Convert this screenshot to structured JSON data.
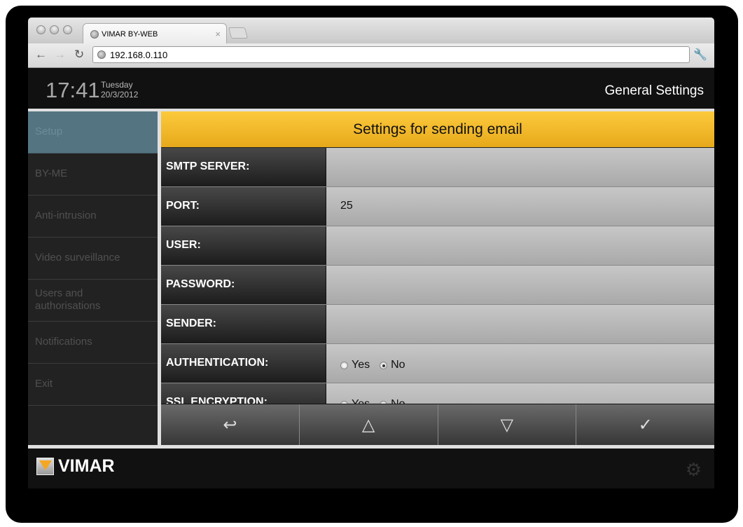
{
  "browser": {
    "tab_title": "VIMAR BY-WEB",
    "url": "192.168.0.110",
    "close": "×"
  },
  "header": {
    "time": "17:41",
    "weekday": "Tuesday",
    "date": "20/3/2012",
    "title": "General Settings"
  },
  "sidebar": {
    "items": [
      {
        "label": "Setup",
        "active": true
      },
      {
        "label": "BY-ME"
      },
      {
        "label": "Anti-intrusion"
      },
      {
        "label": "Video surveillance"
      },
      {
        "label": "Users and authorisations"
      },
      {
        "label": "Notifications"
      },
      {
        "label": "Exit"
      }
    ]
  },
  "panel": {
    "title": "Settings for sending email",
    "rows": [
      {
        "label": "SMTP SERVER:",
        "value": ""
      },
      {
        "label": "PORT:",
        "value": "25"
      },
      {
        "label": "USER:",
        "value": ""
      },
      {
        "label": "PASSWORD:",
        "value": ""
      },
      {
        "label": "SENDER:",
        "value": ""
      }
    ],
    "authentication": {
      "label": "AUTHENTICATION:",
      "yes": "Yes",
      "no": "No",
      "selected": "No"
    },
    "ssl": {
      "label": "SSL ENCRYPTION:",
      "yes": "Yes",
      "no": "No",
      "selected": "No"
    }
  },
  "buttons": {
    "back": "↩",
    "up": "△",
    "down": "▽",
    "confirm": "✓"
  },
  "footer": {
    "brand": "VIMAR"
  },
  "colors": {
    "accent": "#f8c02f",
    "active_sidebar": "#557482"
  }
}
